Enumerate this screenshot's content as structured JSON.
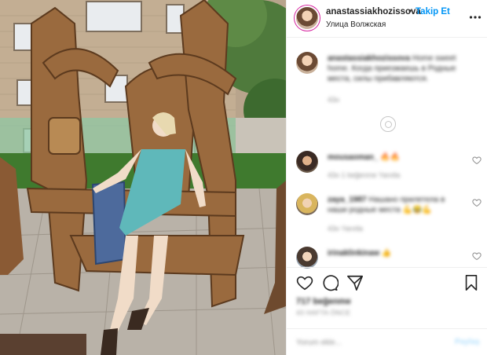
{
  "post": {
    "username": "anastassiakhozissova",
    "follow_label": "Takip Et",
    "separator": "•",
    "location": "Улица Волжская",
    "more_icon": "more-dots-icon"
  },
  "comments": [
    {
      "username": "anastassiakhozissova",
      "text": "Home sweet home. Когда приезжаешь в Родные места, силы прибавляются.",
      "meta": "43н",
      "blurred": true
    },
    {
      "username": "mousaoman_",
      "text": "🔥🔥",
      "meta": "43н   1 beğenme   Yanıtla",
      "blurred": true
    },
    {
      "username": "zaya_1987",
      "text": "Нашано прилетела в наши родные места 💪😂💪",
      "meta": "43н   Yanıtla",
      "blurred": true
    },
    {
      "username": "irinaklinkinaw",
      "text": "👍",
      "meta": "",
      "blurred": true
    }
  ],
  "actions": {
    "like_icon": "heart-icon",
    "comment_icon": "comment-bubble-icon",
    "share_icon": "paper-plane-icon",
    "save_icon": "bookmark-icon"
  },
  "stats": {
    "likes": "717 beğenme",
    "date": "43 HAFTA ÖNCE"
  },
  "add_comment": {
    "placeholder": "Yorum ekle...",
    "post_label": "Paylaş"
  },
  "colors": {
    "accent": "#0095f6",
    "post_disabled": "#b2dffc",
    "text": "#262626",
    "muted": "#8e8e8e"
  }
}
